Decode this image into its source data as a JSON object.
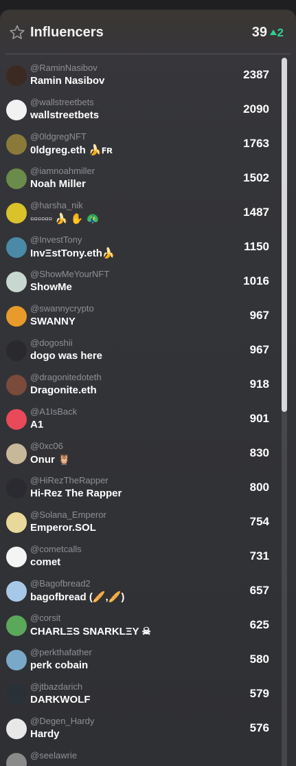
{
  "header": {
    "title": "Influencers",
    "count": "39",
    "delta": "2",
    "icons": {
      "star": "star-outline-icon",
      "delta": "triangle-up-icon"
    },
    "colors": {
      "delta": "#2fcf8f"
    }
  },
  "rows": [
    {
      "handle": "@RaminNasibov",
      "name": "Ramin Nasibov",
      "score": "2387",
      "avatar": "#3b2a22"
    },
    {
      "handle": "@wallstreetbets",
      "name": "wallstreetbets",
      "score": "2090",
      "avatar": "#f2f2f2"
    },
    {
      "handle": "@0ldgregNFT",
      "name": "0ldgreg.eth 🍌ꜰʀ",
      "score": "1763",
      "avatar": "#8a7a3a"
    },
    {
      "handle": "@iamnoahmiller",
      "name": "Noah Miller",
      "score": "1502",
      "avatar": "#6b8b4a"
    },
    {
      "handle": "@harsha_nik",
      "name": "▫▫▫▫▫▫ 🍌 ✋ 🦚",
      "score": "1487",
      "avatar": "#d9c22a"
    },
    {
      "handle": "@InvestTony",
      "name": "InvΞstTony.eth🍌",
      "score": "1150",
      "avatar": "#4a8aa8"
    },
    {
      "handle": "@ShowMeYourNFT",
      "name": "ShowMe",
      "score": "1016",
      "avatar": "#c8d8d0"
    },
    {
      "handle": "@swannycrypto",
      "name": "SWANNY",
      "score": "967",
      "avatar": "#e89a2a"
    },
    {
      "handle": "@dogoshii",
      "name": "dogo was here",
      "score": "967",
      "avatar": "#2a2a2e"
    },
    {
      "handle": "@dragonitedoteth",
      "name": "Dragonite.eth",
      "score": "918",
      "avatar": "#7a4a3a"
    },
    {
      "handle": "@A1IsBack",
      "name": "A1",
      "score": "901",
      "avatar": "#e84a5a"
    },
    {
      "handle": "@0xc06",
      "name": "Onur 🦉",
      "score": "830",
      "avatar": "#c8b89a"
    },
    {
      "handle": "@HiRezTheRapper",
      "name": "Hi-Rez The Rapper",
      "score": "800",
      "avatar": "#2a2a30"
    },
    {
      "handle": "@Solana_Emperor",
      "name": "Emperor.SOL",
      "score": "754",
      "avatar": "#e8d89a"
    },
    {
      "handle": "@cometcalls",
      "name": "comet",
      "score": "731",
      "avatar": "#f4f4f4"
    },
    {
      "handle": "@Bagofbread2",
      "name": "bagofbread (🥖,🥖)",
      "score": "657",
      "avatar": "#a8c8e8"
    },
    {
      "handle": "@corsit",
      "name": "CHARLΞS SNARKLΞY ☠",
      "score": "625",
      "avatar": "#5aa85a"
    },
    {
      "handle": "@perkthafather",
      "name": "perk cobain",
      "score": "580",
      "avatar": "#7aa8c8"
    },
    {
      "handle": "@jtbazdarich",
      "name": "DARKWOLF",
      "score": "579",
      "avatar": "#2a3038"
    },
    {
      "handle": "@Degen_Hardy",
      "name": "Hardy",
      "score": "576",
      "avatar": "#e8e8e8"
    },
    {
      "handle": "@seelawrie",
      "name": "",
      "score": "",
      "avatar": "#8a8a8a"
    }
  ]
}
